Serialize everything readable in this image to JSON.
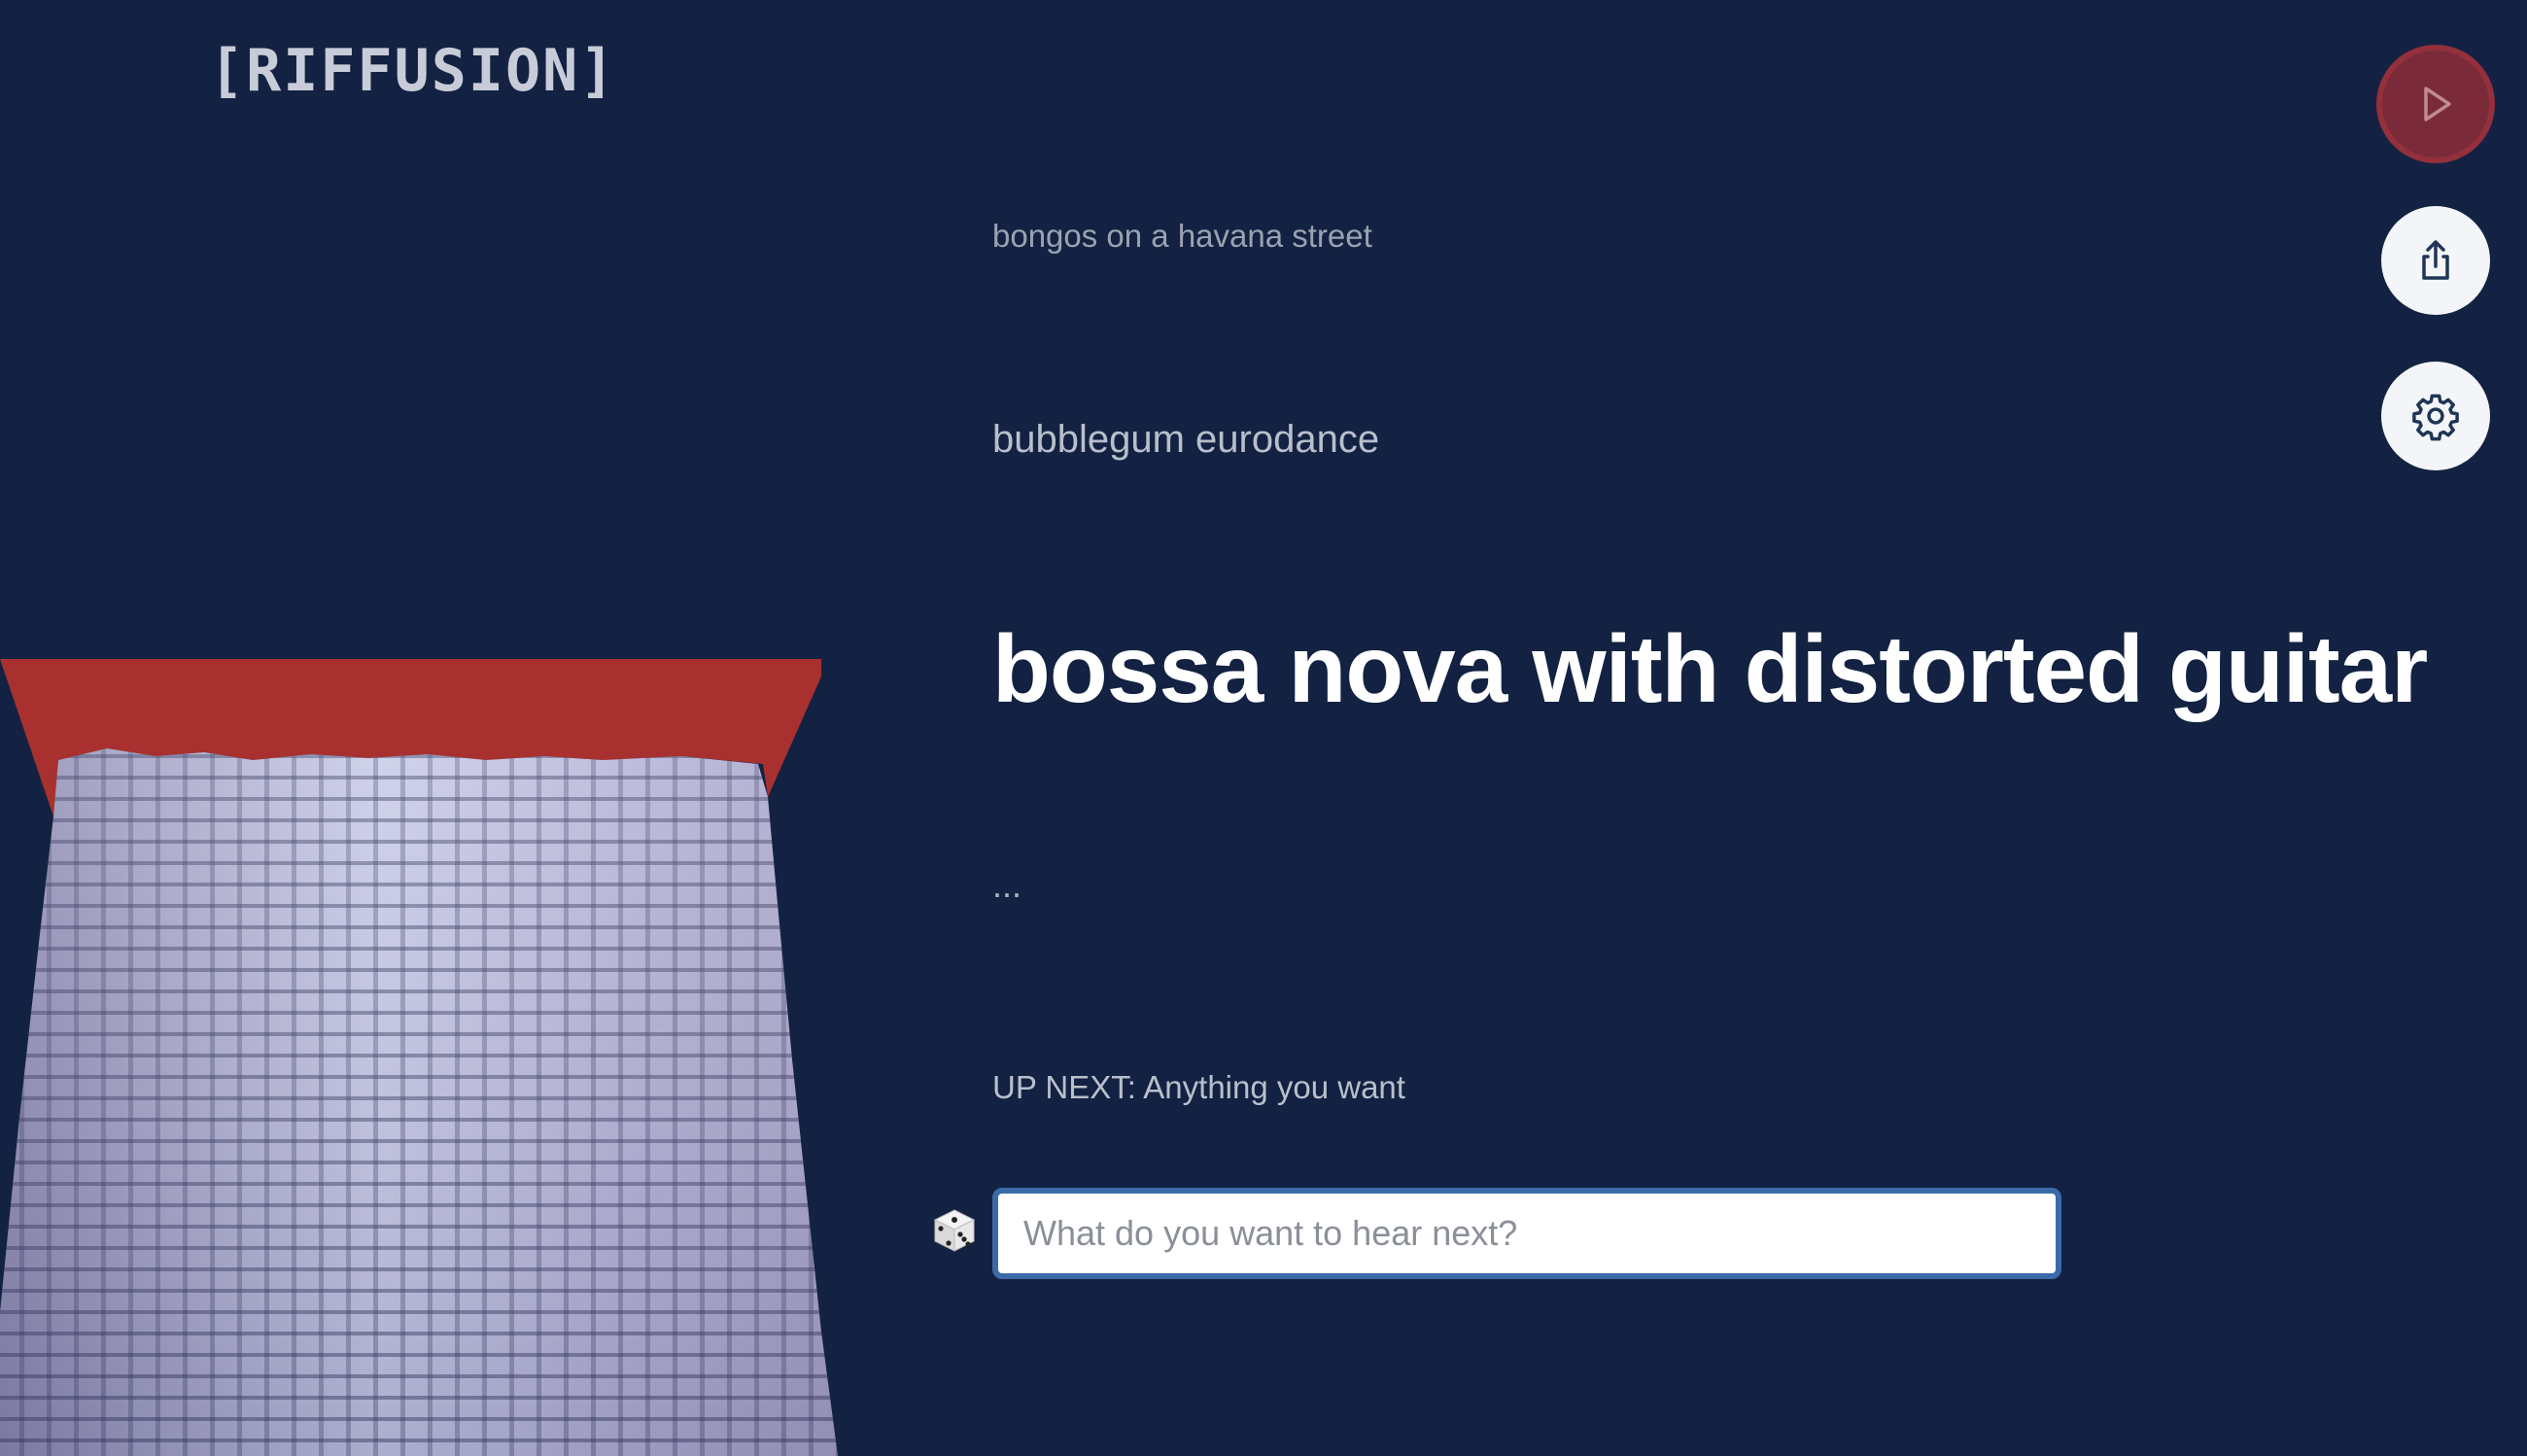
{
  "app": {
    "logo": "[RIFFUSION]"
  },
  "prompts": {
    "previous_2": "bongos on a havana street",
    "previous_1": "bubblegum eurodance",
    "current": "bossa nova with distorted guitar",
    "pending": "..."
  },
  "up_next": {
    "label": "UP NEXT: Anything you want"
  },
  "input": {
    "placeholder": "What do you want to hear next?",
    "value": ""
  },
  "controls": {
    "play_icon": "play-icon",
    "share_icon": "share-icon",
    "settings_icon": "gear-icon",
    "dice_icon": "dice-icon"
  },
  "colors": {
    "background": "#132242",
    "play_button": "#7a2a38",
    "spectrogram_top": "#a8312f",
    "input_border": "#3b6aa8"
  }
}
